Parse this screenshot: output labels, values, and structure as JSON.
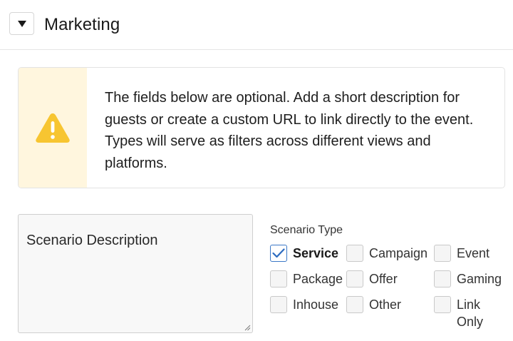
{
  "section": {
    "title": "Marketing",
    "toggle_icon": "caret-down-icon"
  },
  "alert": {
    "icon": "warning-triangle-icon",
    "icon_color": "#f7c531",
    "background": "#fff6de",
    "message": "The fields below are optional. Add a short description for guests or create a custom URL to link directly to the event. Types will serve as filters across different views and platforms."
  },
  "description": {
    "label": "Scenario Description"
  },
  "scenario_type": {
    "label": "Scenario Type",
    "options": [
      {
        "label": "Service",
        "checked": true
      },
      {
        "label": "Campaign",
        "checked": false
      },
      {
        "label": "Event",
        "checked": false
      },
      {
        "label": "Package",
        "checked": false
      },
      {
        "label": "Offer",
        "checked": false
      },
      {
        "label": "Gaming",
        "checked": false
      },
      {
        "label": "Inhouse",
        "checked": false
      },
      {
        "label": "Other",
        "checked": false
      },
      {
        "label": "Link Only",
        "checked": false
      }
    ]
  },
  "colors": {
    "check_accent": "#2d6cc0"
  }
}
